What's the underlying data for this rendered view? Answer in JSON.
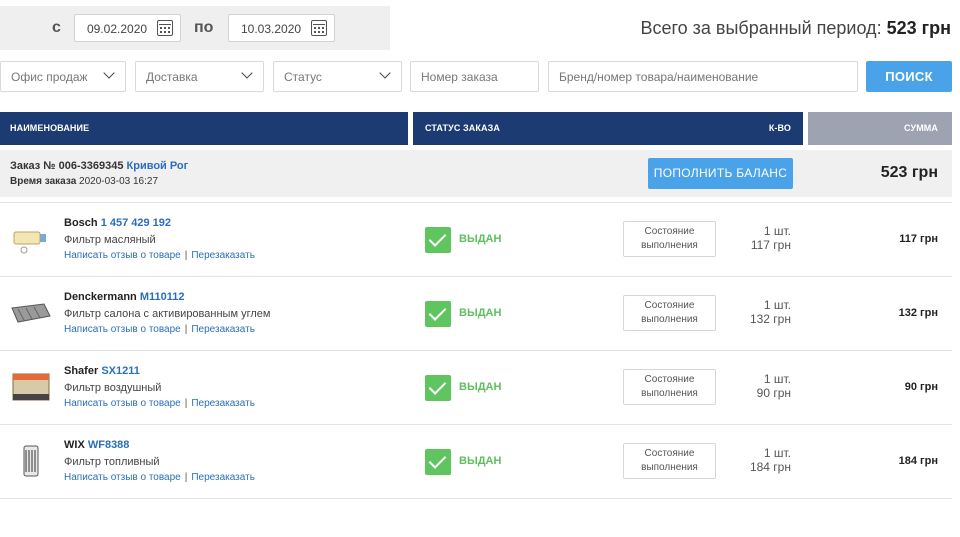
{
  "period": {
    "from_label": "с",
    "from_date": "09.02.2020",
    "to_label": "по",
    "to_date": "10.03.2020",
    "total_label": "Всего за выбранный период:",
    "total_value": "523 грн"
  },
  "filters": {
    "office": "Офис продаж",
    "delivery": "Доставка",
    "status": "Статус",
    "order_no_placeholder": "Номер заказа",
    "brand_placeholder": "Бренд/номер товара/наименование",
    "search_label": "ПОИСК"
  },
  "table_header": {
    "name": "НАИМЕНОВАНИЕ",
    "status": "СТАТУС ЗАКАЗА",
    "qty": "К-ВО",
    "sum": "СУММА"
  },
  "order": {
    "number_label": "Заказ № 006-3369345",
    "city": "Кривой Рог",
    "time_label": "Время заказа",
    "time_value": "2020-03-03 16:27",
    "topup_label": "ПОПОЛНИТЬ БАЛАНС",
    "sum": "523 грн"
  },
  "common": {
    "review_link": "Написать отзыв о товаре",
    "reorder_link": "Перезаказать",
    "link_sep": "|",
    "status_text": "ВЫДАН",
    "state_line1": "Состояние",
    "state_line2": "выполнения"
  },
  "items": [
    {
      "brand": "Bosch",
      "code": "1 457 429 192",
      "name": "Фильтр масляный",
      "qty": "1 шт.",
      "price": "117 грн",
      "sum": "117 грн",
      "icon": "oil-filter-icon"
    },
    {
      "brand": "Denckermann",
      "code": "M110112",
      "name": "Фильтр салона с активированным углем",
      "qty": "1 шт.",
      "price": "132 грн",
      "sum": "132 грн",
      "icon": "cabin-filter-icon"
    },
    {
      "brand": "Shafer",
      "code": "SX1211",
      "name": "Фильтр воздушный",
      "qty": "1 шт.",
      "price": "90 грн",
      "sum": "90 грн",
      "icon": "air-filter-icon"
    },
    {
      "brand": "WIX",
      "code": "WF8388",
      "name": "Фильтр топливный",
      "qty": "1 шт.",
      "price": "184 грн",
      "sum": "184 грн",
      "icon": "fuel-filter-icon"
    }
  ],
  "colors": {
    "header_blue": "#1c3b73",
    "header_gray": "#9ea3b1",
    "button_blue": "#4aa3e8",
    "link_blue": "#2a6ebb",
    "status_green": "#5fc55f"
  }
}
